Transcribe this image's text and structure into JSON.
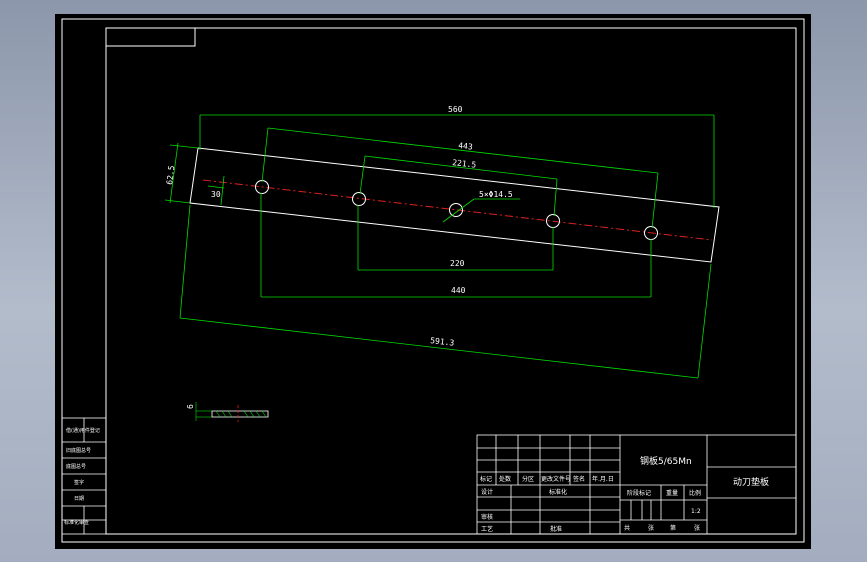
{
  "dimensions": {
    "overall_length": "560",
    "hole_span_outer": "443",
    "hole_span_half": "221.5",
    "hole_spec": "5×Φ14.5",
    "bottom_inner": "220",
    "bottom_outer": "440",
    "diagonal_length": "591.3",
    "width": "62.5",
    "edge_offset": "30"
  },
  "section_view": {
    "thickness": "6"
  },
  "title_block": {
    "material": "钢板5/65Mn",
    "part_name": "动刀垫板",
    "scale": "1:2",
    "labels": {
      "mark": "标记",
      "count": "处数",
      "zone": "分区",
      "change_doc": "更改文件号",
      "signature": "签名",
      "date": "年.月.日",
      "designer": "设计",
      "standardization": "标准化",
      "stage_mark": "阶段标记",
      "weight": "重量",
      "scale_label": "比例",
      "review": "审核",
      "process": "工艺",
      "approve": "批准",
      "total": "共",
      "sheets": "张",
      "sheet_no": "第",
      "sheet": "张"
    }
  },
  "side_strip": [
    "借(通)用件登记",
    "旧底图总号",
    "底图总号",
    "签字",
    "日期",
    "标准化审查"
  ]
}
